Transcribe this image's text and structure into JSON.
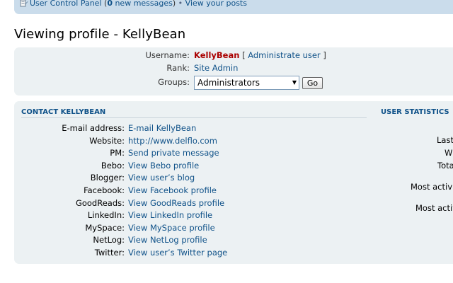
{
  "nav": {
    "ucp_label": "User Control Panel",
    "open_paren": " (",
    "new_messages_count": "0",
    "new_messages_label": " new messages",
    "close_paren": ")",
    "separator": " • ",
    "view_posts": "View your posts"
  },
  "page": {
    "title": "Viewing profile - KellyBean"
  },
  "profile": {
    "username_label": "Username:",
    "username": "KellyBean",
    "admin_open": "[",
    "admin_link": "Administrate user",
    "admin_close": "]",
    "rank_label": "Rank:",
    "rank_value": "Site Admin",
    "groups_label": "Groups:",
    "groups_selected": "Administrators",
    "go_label": "Go"
  },
  "contact": {
    "title": "Contact KellyBean",
    "rows": [
      {
        "label": "E-mail address:",
        "value": "E-mail KellyBean"
      },
      {
        "label": "Website:",
        "value": "http://www.delflo.com"
      },
      {
        "label": "PM:",
        "value": "Send private message"
      },
      {
        "label": "Bebo:",
        "value": "View Bebo profile"
      },
      {
        "label": "Blogger:",
        "value": "View user’s blog"
      },
      {
        "label": "Facebook:",
        "value": "View Facebook profile"
      },
      {
        "label": "GoodReads:",
        "value": "View GoodReads profile"
      },
      {
        "label": "LinkedIn:",
        "value": "View LinkedIn profile"
      },
      {
        "label": "MySpace:",
        "value": "View MySpace profile"
      },
      {
        "label": "NetLog:",
        "value": "View NetLog profile"
      },
      {
        "label": "Twitter:",
        "value": "View user’s Twitter page"
      }
    ]
  },
  "stats": {
    "title": "User Statistics",
    "visible_labels": [
      "Last",
      "W",
      "Tota",
      "Most activ",
      "Most activ"
    ]
  },
  "colors": {
    "link": "#105289",
    "username": "#aa0000",
    "panel_bg": "#ecf1f3",
    "topbar_bg": "#cadceb"
  },
  "icons": {
    "ucp": "user-control-panel-icon",
    "select_arrow": "chevron-down-icon"
  }
}
